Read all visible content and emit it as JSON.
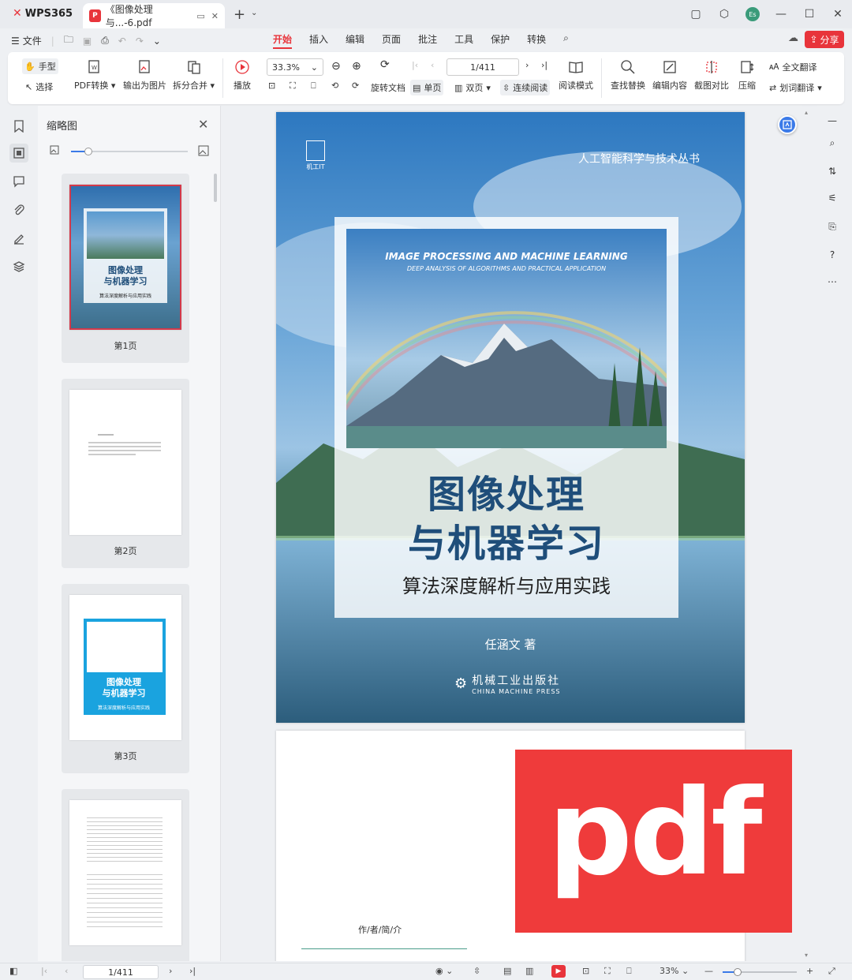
{
  "app": {
    "name": "WPS365",
    "tab_title": "《图像处理与...-6.pdf"
  },
  "menu": {
    "file": "文件",
    "items": [
      "开始",
      "插入",
      "编辑",
      "页面",
      "批注",
      "工具",
      "保护",
      "转换"
    ],
    "active": "开始",
    "share": "分享"
  },
  "toolbar": {
    "hand": "手型",
    "select": "选择",
    "pdf_convert": "PDF转换",
    "export_image": "输出为图片",
    "split_merge": "拆分合并",
    "play": "播放",
    "zoom": "33.3%",
    "page": "1/411",
    "rotate_doc": "旋转文档",
    "single_page": "单页",
    "double_page": "双页",
    "continuous": "连续阅读",
    "read_mode": "阅读模式",
    "find_replace": "查找替换",
    "edit_content": "编辑内容",
    "crop_compare": "截图对比",
    "compress": "压缩",
    "full_translate": "全文翻译",
    "word_translate": "划词翻译"
  },
  "thumbnails": {
    "title": "缩略图",
    "pages": [
      {
        "label": "第1页"
      },
      {
        "label": "第2页"
      },
      {
        "label": "第3页"
      },
      {
        "label": ""
      }
    ]
  },
  "cover": {
    "series": "人工智能科学与技术丛书",
    "publisher_mark": "机工IT",
    "en_title": "IMAGE PROCESSING AND MACHINE LEARNING",
    "en_subtitle": "DEEP ANALYSIS OF ALGORITHMS AND PRACTICAL APPLICATION",
    "title_line1": "图像处理",
    "title_line2": "与机器学习",
    "subtitle": "算法深度解析与应用实践",
    "author": "任涵文  著",
    "press_cn": "机械工业出版社",
    "press_en": "CHINA MACHINE PRESS"
  },
  "page2": {
    "heading": "作/者/简/介"
  },
  "badge": {
    "text": "pdf"
  },
  "status": {
    "page": "1/411",
    "zoom": "33%"
  },
  "colors": {
    "accent": "#e8343b",
    "title_blue": "#1f4e7a",
    "badge_red": "#ef3b3b"
  }
}
